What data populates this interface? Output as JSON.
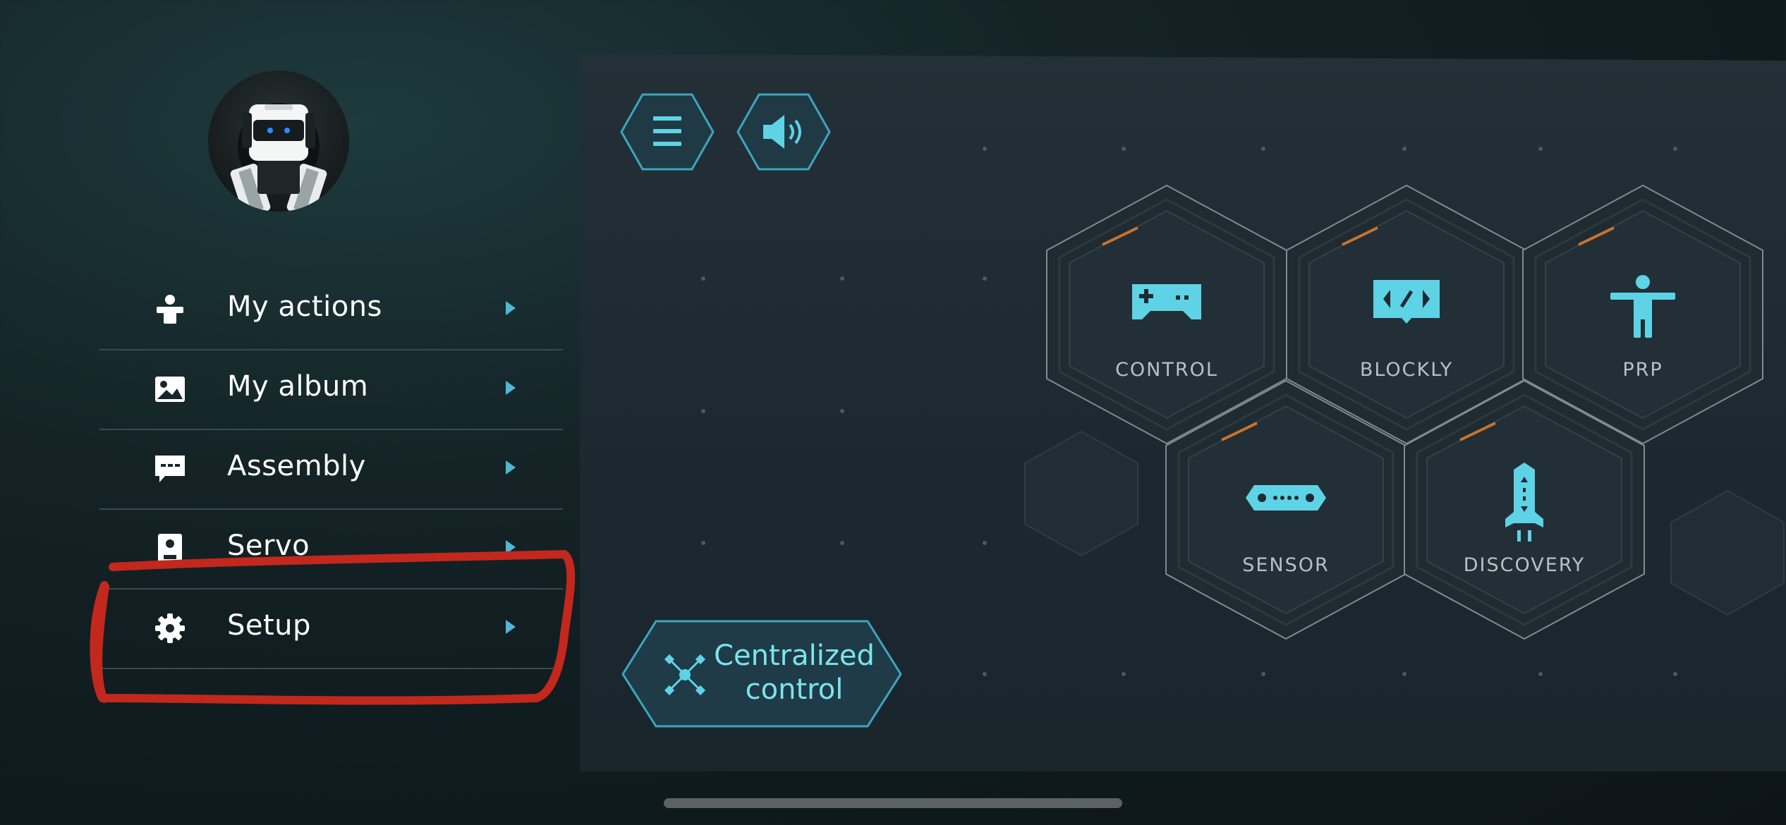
{
  "sidebar": {
    "items": [
      {
        "label": "My actions",
        "icon": "person-icon"
      },
      {
        "label": "My album",
        "icon": "image-icon"
      },
      {
        "label": "Assembly",
        "icon": "chat-icon"
      },
      {
        "label": "Servo",
        "icon": "servo-icon"
      },
      {
        "label": "Setup",
        "icon": "gear-icon"
      }
    ]
  },
  "toolbar": {
    "menu_icon": "hamburger-menu-icon",
    "sound_icon": "speaker-icon"
  },
  "modules": [
    {
      "label": "CONTROL",
      "icon": "gamepad-icon"
    },
    {
      "label": "BLOCKLY",
      "icon": "code-block-icon"
    },
    {
      "label": "PRP",
      "icon": "human-figure-icon"
    },
    {
      "label": "SENSOR",
      "icon": "sensor-icon"
    },
    {
      "label": "DISCOVERY",
      "icon": "rocket-icon"
    }
  ],
  "central": {
    "line1": "Centralized",
    "line2": "control",
    "icon": "network-hub-icon"
  },
  "colors": {
    "accent": "#5ed3e6",
    "annotation": "#c2281d",
    "orange_accent": "#c8732e"
  }
}
